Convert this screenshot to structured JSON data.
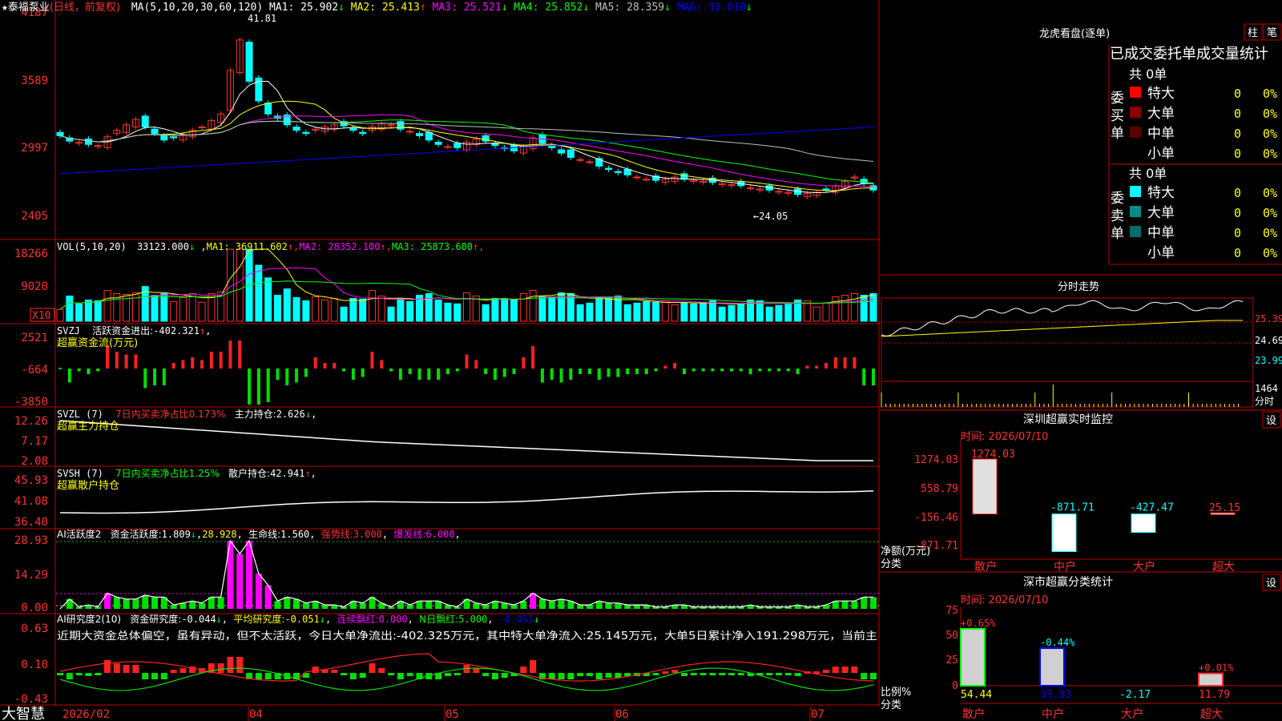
{
  "app": {
    "brand": "大智慧"
  },
  "main": {
    "star": "★",
    "stock": "泰福泵业",
    "mode": "(日线，前复权)",
    "ma_label": "MA(5,10,20,30,60,120)",
    "ma_values": [
      {
        "name": "MA1",
        "value": "25.902",
        "arrow": "↓",
        "color": "#ffffff"
      },
      {
        "name": "MA2",
        "value": "25.413",
        "arrow": "↑",
        "color": "#ffff00"
      },
      {
        "name": "MA3",
        "value": "25.521",
        "arrow": "↓",
        "color": "#ff00ff"
      },
      {
        "name": "MA4",
        "value": "25.852",
        "arrow": "↓",
        "color": "#00ff00"
      },
      {
        "name": "MA5",
        "value": "28.359",
        "arrow": "↓",
        "color": "#c0c0c0"
      },
      {
        "name": "MA6",
        "value": "30.010",
        "arrow": "↓",
        "color": "#0000ff"
      }
    ],
    "y_ticks": [
      "4187",
      "3589",
      "2997",
      "2405"
    ],
    "high_label": "41.81",
    "low_label": "24.05"
  },
  "vol": {
    "label": "VOL(5,10,20)",
    "value": "33123.000",
    "ma": [
      {
        "name": "MA1",
        "value": "36911.602",
        "arrow": "↑",
        "color": "#ffff00"
      },
      {
        "name": "MA2",
        "value": "28352.100",
        "arrow": "↑",
        "color": "#ff00ff"
      },
      {
        "name": "MA3",
        "value": "25873.600",
        "arrow": "↑",
        "color": "#00ff00"
      }
    ],
    "y_ticks": [
      "18266",
      "9020"
    ],
    "unit": "X10"
  },
  "svzj": {
    "label": "SVZJ",
    "title": "活跃资金进出:",
    "value": "-402.321",
    "arrow": "↑",
    "subtitle": "超赢资金流(万元)",
    "y_ticks": [
      "2521",
      "-664",
      "-3850"
    ]
  },
  "svzl": {
    "label": "SVZL (7)",
    "ratio": "7日内买卖净占比0.173%",
    "hold_label": "主力持仓:",
    "hold_value": "2.626",
    "arrow": "↓",
    "subtitle": "超赢主力持仓",
    "y_ticks": [
      "12.26",
      "7.17",
      "2.08"
    ]
  },
  "svsh": {
    "label": "SVSH (7)",
    "ratio": "7日内买卖净占比1.25%",
    "hold_label": "散户持仓:",
    "hold_value": "42.941",
    "arrow": "↑",
    "subtitle": "超赢散户持仓",
    "y_ticks": [
      "45.93",
      "41.08",
      "36.40"
    ]
  },
  "ai_active": {
    "label": "AI活跃度2",
    "s1": "资金活跃度:",
    "v1": "1.809",
    "v2": "28.928",
    "s3": "生命线:",
    "v3": "1.560",
    "s4": "强势线:",
    "v4": "3.000",
    "s5": "爆发线:",
    "v5": "6.000",
    "y_ticks": [
      "28.93",
      "14.29",
      "0.00"
    ]
  },
  "ai_research": {
    "label": "AI研究度2(10)",
    "s1": "资金研究度:",
    "v1": "-0.044",
    "s2": "平均研究度:",
    "v2": "-0.051",
    "s3": "连续飘红:",
    "v3": "0.000",
    "s4": "N日飘红:",
    "v4": "5.000",
    "v5": "-0.051",
    "note": "近期大资金总体偏空，虽有异动，但不太活跃，今日大单净流出:-402.325万元，其中特大单净流入:25.145万元，大单5日累计净入191.298万元，当前主",
    "y_ticks": [
      "0.63",
      "0.10",
      "-0.43"
    ]
  },
  "x_axis": {
    "labels": [
      "2026/02",
      "04",
      "05",
      "06",
      "07"
    ]
  },
  "right": {
    "longhu": {
      "title": "龙虎看盘(逐单)",
      "tab1": "柱",
      "tab2": "笔",
      "heading": "已成交委托单成交量统计",
      "buy": {
        "side": "委买单",
        "total": "共 0单",
        "rows": [
          {
            "label": "特大",
            "count": "0",
            "pct": "0%",
            "color": "#ff0000"
          },
          {
            "label": "大单",
            "count": "0",
            "pct": "0%",
            "color": "#8b0000"
          },
          {
            "label": "中单",
            "count": "0",
            "pct": "0%",
            "color": "#5a0000"
          },
          {
            "label": "小单",
            "count": "0",
            "pct": "0%",
            "color": "#000000"
          }
        ]
      },
      "sell": {
        "side": "委卖单",
        "total": "共 0单",
        "rows": [
          {
            "label": "特大",
            "count": "0",
            "pct": "0%",
            "color": "#00ffff"
          },
          {
            "label": "大单",
            "count": "0",
            "pct": "0%",
            "color": "#008b8b"
          },
          {
            "label": "中单",
            "count": "0",
            "pct": "0%",
            "color": "#006b6b"
          },
          {
            "label": "小单",
            "count": "0",
            "pct": "0%",
            "color": "#000000"
          }
        ]
      }
    },
    "intraday": {
      "title": "分时走势",
      "y_ticks": [
        "25.39",
        "24.69",
        "23.99"
      ],
      "vol_label": "1464",
      "unit": "分时"
    },
    "monitor": {
      "title": "深圳超赢实时监控",
      "set": "设",
      "time": "时间: 2026/07/10",
      "y_ticks": [
        "1274.03",
        "558.79",
        "-156.46",
        "-871.71"
      ],
      "ylabel": "净额(万元)",
      "xlabel": "分类",
      "categories": [
        "散户",
        "中户",
        "大户",
        "超大"
      ],
      "values": [
        1274.03,
        -871.71,
        -427.47,
        25.15
      ],
      "value_labels": [
        "1274.03",
        "-871.71",
        "-427.47",
        "25.15"
      ]
    },
    "classify": {
      "title": "深市超赢分类统计",
      "set": "设",
      "time": "时间: 2026/07/10",
      "y_ticks": [
        "75",
        "50",
        "25",
        "0"
      ],
      "ylabel": "比例%",
      "xlabel": "分类",
      "categories": [
        "散户",
        "中户",
        "大户",
        "超大"
      ],
      "bar_values": [
        54.44,
        35.93,
        0,
        11.79
      ],
      "pct_labels": [
        "+0.65%",
        "-0.44%",
        "",
        "+0.01%"
      ],
      "bottom_labels": [
        "54.44",
        "35.93",
        "-2.17",
        "11.79"
      ]
    }
  },
  "chart_data": {
    "type": "candlestick",
    "title": "泰福泵业 (日线，前复权)",
    "ylim": [
      2300,
      4200
    ],
    "x_range": [
      "2026/02",
      "2026/07/10"
    ],
    "annotations": {
      "high": 41.81,
      "low": 24.05
    },
    "approx_close_series": [
      3100,
      3050,
      3040,
      3020,
      3010,
      3090,
      3150,
      3200,
      3250,
      3180,
      3120,
      3060,
      3080,
      3110,
      3150,
      3180,
      3240,
      3300,
      3700,
      3980,
      3600,
      3420,
      3300,
      3260,
      3200,
      3150,
      3120,
      3160,
      3180,
      3200,
      3190,
      3150,
      3120,
      3180,
      3210,
      3200,
      3160,
      3140,
      3100,
      3060,
      3020,
      3000,
      2990,
      3040,
      3070,
      3050,
      3010,
      2980,
      2960,
      3000,
      3080,
      3030,
      2990,
      2940,
      2900,
      2880,
      2860,
      2820,
      2790,
      2760,
      2740,
      2720,
      2700,
      2690,
      2700,
      2720,
      2700,
      2690,
      2680,
      2670,
      2660,
      2650,
      2640,
      2620,
      2610,
      2600,
      2590,
      2580,
      2560,
      2570,
      2580,
      2600,
      2640,
      2680,
      2720,
      2660,
      2600
    ]
  }
}
